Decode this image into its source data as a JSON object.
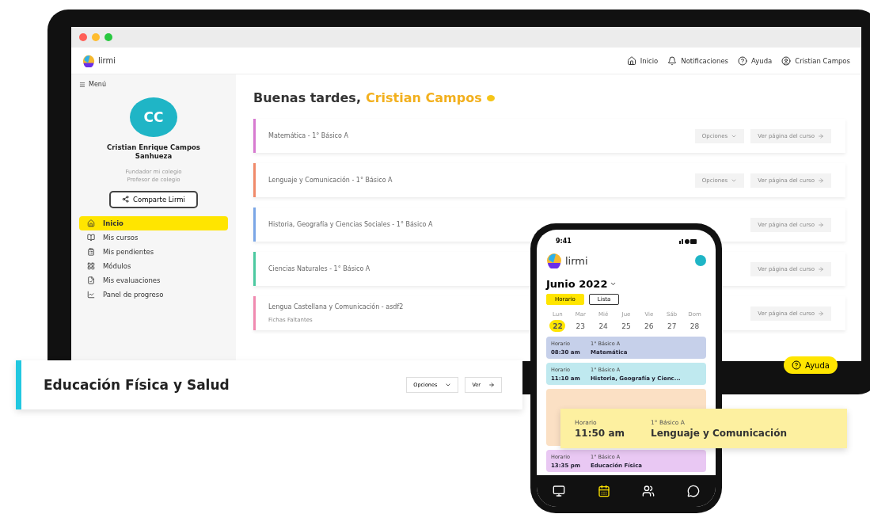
{
  "app": {
    "logo": "lirmi",
    "nav": [
      "Inicio",
      "Notificaciones",
      "Ayuda",
      "Cristian Campos"
    ]
  },
  "sidebar": {
    "menu": "Menú",
    "initials": "CC",
    "name": "Cristian Enrique Campos Sanhueza",
    "roles": [
      "Fundador mi colegio",
      "Profesor de colegio"
    ],
    "share": "Comparte Lirmi",
    "items": [
      {
        "label": "Inicio",
        "selected": true
      },
      {
        "label": "Mis cursos",
        "selected": false
      },
      {
        "label": "Mis pendientes",
        "selected": false
      },
      {
        "label": "Módulos",
        "selected": false
      },
      {
        "label": "Mis evaluaciones",
        "selected": false
      },
      {
        "label": "Panel de progreso",
        "selected": false
      }
    ]
  },
  "greeting": {
    "text": "Buenas tardes,",
    "name": "Cristian Campos"
  },
  "courses": [
    {
      "title": "Matemática - 1° Básico A",
      "color": "#d77ad0",
      "options": "Opciones",
      "view": "Ver página del curso"
    },
    {
      "title": "Lenguaje y Comunicación - 1° Básico A",
      "color": "#f08a6a",
      "options": "Opciones",
      "view": "Ver página del curso"
    },
    {
      "title": "Historia, Geografía y Ciencias Sociales - 1° Básico A",
      "color": "#7aa6e6",
      "view": "Ver página del curso"
    },
    {
      "title": "Ciencias Naturales - 1° Básico A",
      "color": "#4cc9a0",
      "view": "Ver página del curso"
    },
    {
      "title": "Lengua Castellana y Comunicación - asdf2",
      "color": "#f08ab0",
      "note": "Fichas Faltantes",
      "view": "Ver página del curso"
    }
  ],
  "help": "Ayuda",
  "floating_course": {
    "title": "Educación Física y Salud",
    "color": "#22c8e0",
    "options": "Opciones",
    "view": "Ver"
  },
  "phone": {
    "time": "9:41",
    "logo": "lirmi",
    "month": "Junio 2022",
    "views": [
      {
        "label": "Horario",
        "selected": true
      },
      {
        "label": "Lista",
        "selected": false
      }
    ],
    "weekdays": [
      "Lun",
      "Mar",
      "Mié",
      "Jue",
      "Vie",
      "Sáb",
      "Dom"
    ],
    "days": [
      {
        "label": "22",
        "selected": true
      },
      {
        "label": "23",
        "selected": false
      },
      {
        "label": "24",
        "selected": false
      },
      {
        "label": "25",
        "selected": false
      },
      {
        "label": "26",
        "selected": false
      },
      {
        "label": "27",
        "selected": false
      },
      {
        "label": "28",
        "selected": false
      }
    ],
    "events": [
      {
        "label": "Horario",
        "time": "08:30 am",
        "group": "1° Básico A",
        "subject": "Matemática",
        "color": "#c6d0ea"
      },
      {
        "label": "Horario",
        "time": "11:10 am",
        "group": "1° Básico A",
        "subject": "Historia, Geografía y Cienc...",
        "color": "#bfe9ef"
      },
      {
        "color": "#fbe0c4"
      },
      {
        "label": "Horario",
        "time": "13:35 pm",
        "group": "1° Básico A",
        "subject": "Educación Física",
        "color": "#e9c8f3"
      }
    ],
    "tabs": [
      {
        "kind": "screen",
        "selected": false
      },
      {
        "kind": "calendar",
        "selected": true
      },
      {
        "kind": "people",
        "selected": false
      },
      {
        "kind": "chat",
        "selected": false
      }
    ]
  },
  "highlight": {
    "label": "Horario",
    "time": "11:50 am",
    "group": "1° Básico A",
    "subject": "Lenguaje y Comunicación"
  }
}
